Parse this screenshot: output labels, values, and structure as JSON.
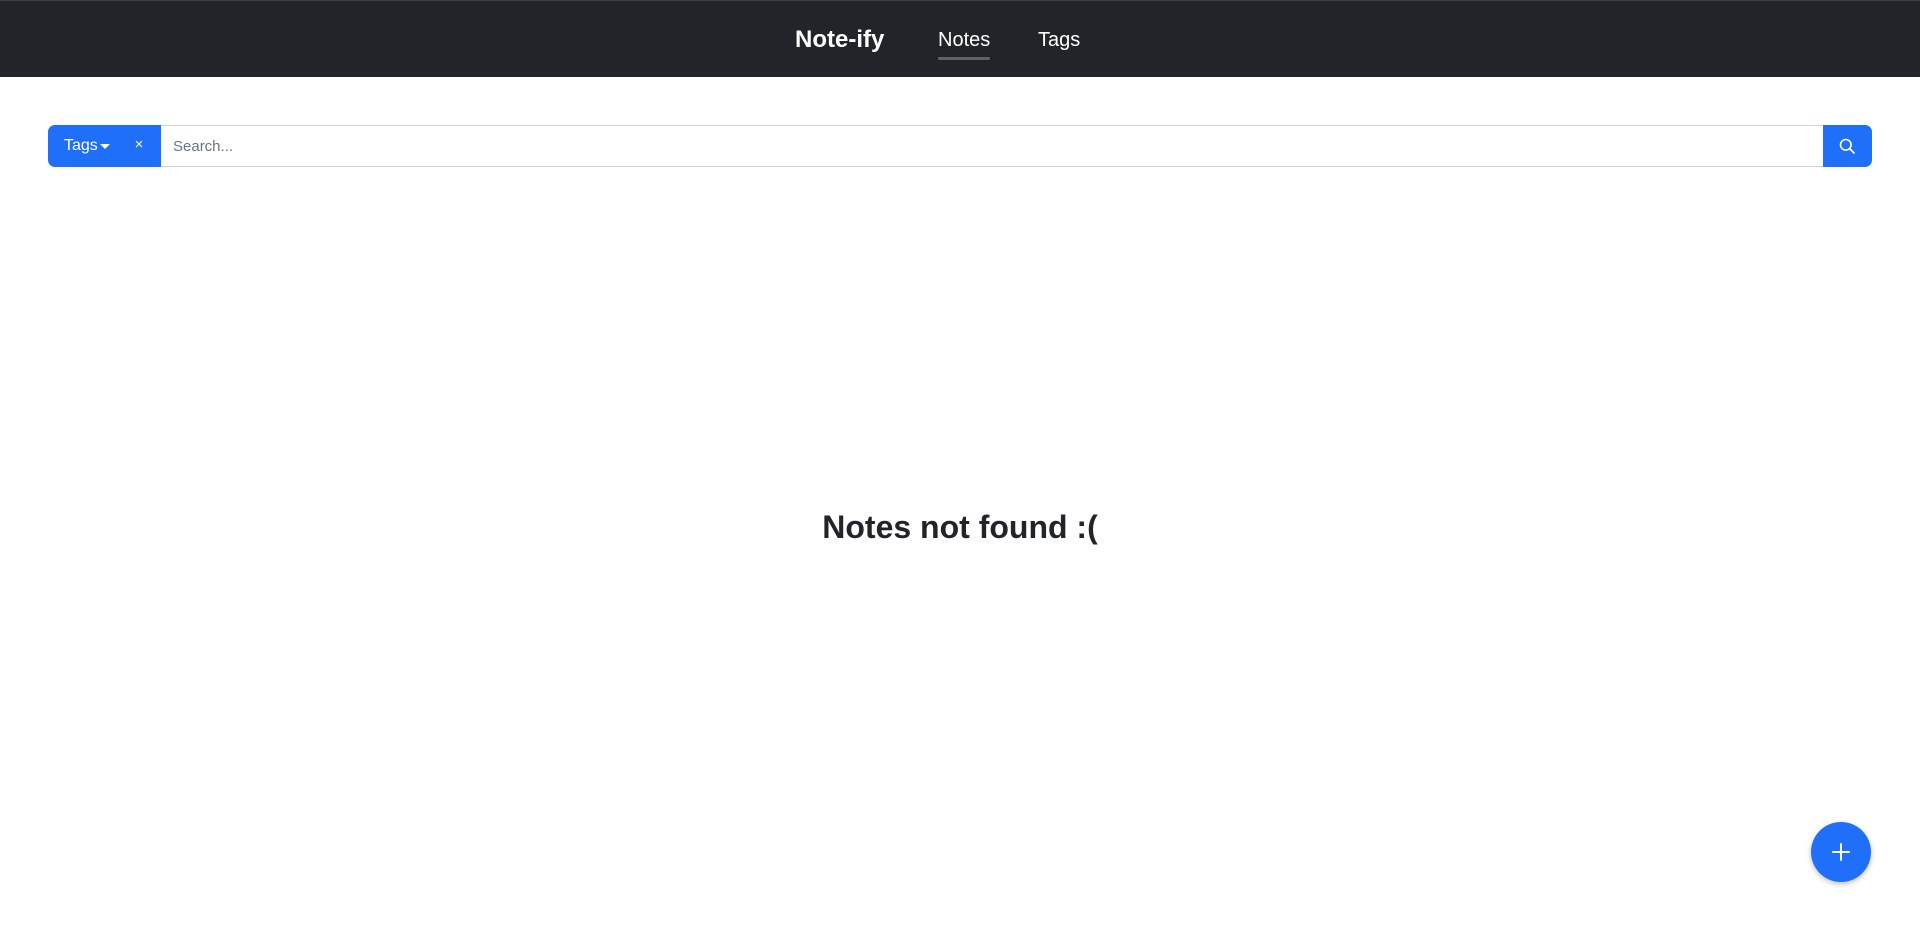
{
  "navbar": {
    "brand": "Note-ify",
    "links": [
      {
        "label": "Notes",
        "active": true
      },
      {
        "label": "Tags",
        "active": false
      }
    ]
  },
  "search": {
    "tags_button_label": "Tags",
    "clear_label": "×",
    "placeholder": "Search...",
    "value": "",
    "search_icon": "search-icon"
  },
  "main": {
    "empty_message": "Notes not found :("
  },
  "fab": {
    "icon": "plus-icon"
  },
  "colors": {
    "navbar_bg": "#212529",
    "accent": "#1f6ff8",
    "text": "#212529"
  }
}
